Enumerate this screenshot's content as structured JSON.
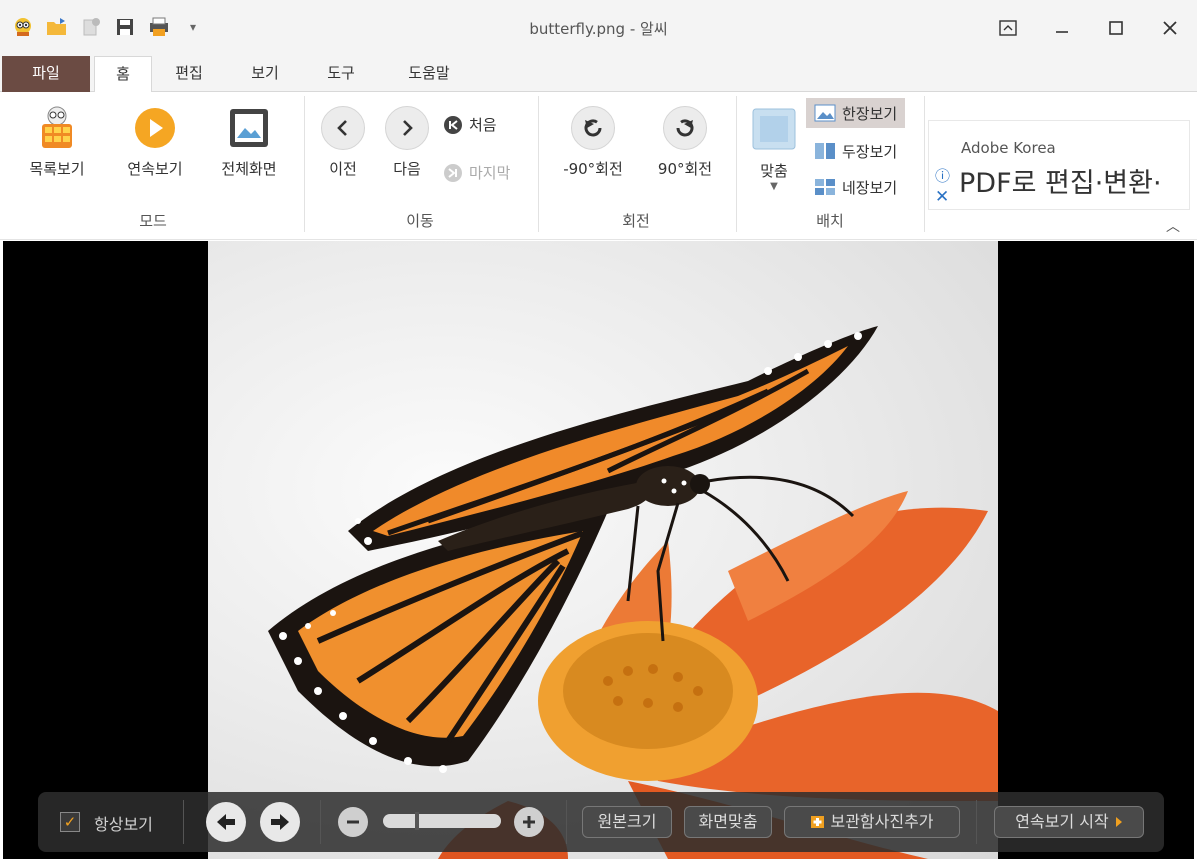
{
  "window": {
    "title": "butterfly.png - 알씨"
  },
  "tabs": {
    "file": "파일",
    "home": "홈",
    "edit": "편집",
    "view": "보기",
    "tools": "도구",
    "help": "도움말"
  },
  "ribbon": {
    "mode": {
      "label": "모드",
      "list_view": "목록보기",
      "slideshow": "연속보기",
      "fullscreen": "전체화면"
    },
    "move": {
      "label": "이동",
      "prev": "이전",
      "next": "다음",
      "first": "처음",
      "last": "마지막"
    },
    "rotate": {
      "label": "회전",
      "left": "-90°회전",
      "right": "90°회전"
    },
    "layout": {
      "label": "배치",
      "fit": "맞춤",
      "single": "한장보기",
      "double": "두장보기",
      "quad": "네장보기"
    }
  },
  "ad": {
    "brand": "Adobe Korea",
    "message": "PDF로 편집·변환·"
  },
  "viewer_bar": {
    "always_show": "항상보기",
    "original_size": "원본크기",
    "fit_screen": "화면맞춤",
    "add_to_storage": "보관함사진추가",
    "start_slideshow": "연속보기 시작",
    "zoom_level": 0.28
  },
  "colors": {
    "file_tab": "#6b4b43",
    "accent_orange": "#f5a623",
    "slideshow_arrow": "#f0a020"
  }
}
